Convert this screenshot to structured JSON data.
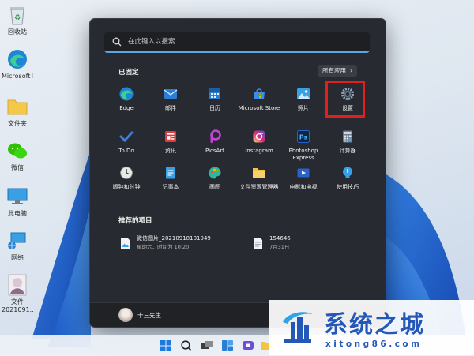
{
  "desktop": {
    "icons": [
      {
        "label": "回收站",
        "icon": "recycle-bin-icon"
      },
      {
        "label": "Microsoft Edge",
        "icon": "edge-icon"
      },
      {
        "label": "文件夹",
        "icon": "folder-icon"
      },
      {
        "label": "微信",
        "icon": "wechat-icon"
      },
      {
        "label": "此电脑",
        "icon": "computer-icon"
      },
      {
        "label": "网络",
        "icon": "network-icon"
      },
      {
        "label": "文件",
        "sublabel": "2021091...",
        "icon": "image-file-icon"
      }
    ]
  },
  "start_menu": {
    "search": {
      "placeholder": "在此键入以搜索"
    },
    "pinned_heading": "已固定",
    "all_apps_label": "所有应用",
    "pinned_apps": [
      {
        "name": "Edge",
        "icon": "edge-icon",
        "color": "#2fb4a4"
      },
      {
        "name": "邮件",
        "icon": "mail-icon",
        "color": "#2a7fd4"
      },
      {
        "name": "日历",
        "icon": "calendar-icon",
        "color": "#2a7fd4"
      },
      {
        "name": "Microsoft Store",
        "icon": "store-icon",
        "color": "#3a8ee6"
      },
      {
        "name": "照片",
        "icon": "photos-icon",
        "color": "#3aa0e6"
      },
      {
        "name": "设置",
        "icon": "gear-icon",
        "color": "#8fa3b8"
      },
      {
        "name": "To Do",
        "icon": "todo-icon",
        "color": "#3b7ee0"
      },
      {
        "name": "资讯",
        "icon": "news-icon",
        "color": "#e03a3a"
      },
      {
        "name": "PicsArt",
        "icon": "picsart-icon",
        "color": "#c642d6"
      },
      {
        "name": "Instagram",
        "icon": "instagram-icon",
        "color": "#e1306c"
      },
      {
        "name": "Photoshop Express",
        "icon": "photoshop-icon",
        "color": "#2a62c9"
      },
      {
        "name": "计算器",
        "icon": "calculator-icon",
        "color": "#6b7a8c"
      },
      {
        "name": "闹钟和时钟",
        "icon": "clock-icon",
        "color": "#d0d0d0"
      },
      {
        "name": "记事本",
        "icon": "notepad-icon",
        "color": "#3aa0e6"
      },
      {
        "name": "画图",
        "icon": "paint-icon",
        "color": "#2fb4a4"
      },
      {
        "name": "文件资源管理器",
        "icon": "file-explorer-icon",
        "color": "#f3c342"
      },
      {
        "name": "电影和电视",
        "icon": "movies-icon",
        "color": "#2a62c9"
      },
      {
        "name": "使用技巧",
        "icon": "tips-icon",
        "color": "#3aa0e6"
      }
    ],
    "recommended_heading": "推荐的项目",
    "recommended": [
      {
        "title": "微信图片_20210918101949",
        "subtitle": "星期六，时间为 10:20",
        "icon": "image-file-icon"
      },
      {
        "title": "154646",
        "subtitle": "7月31日",
        "icon": "document-icon"
      }
    ],
    "user": {
      "name": "十三先生"
    }
  },
  "taskbar": {
    "icons": [
      "windows-start-icon",
      "search-icon",
      "task-view-icon",
      "widgets-icon",
      "chat-icon",
      "file-explorer-icon"
    ]
  },
  "watermark": {
    "title": "系统之城",
    "url": "xitong86.com"
  }
}
